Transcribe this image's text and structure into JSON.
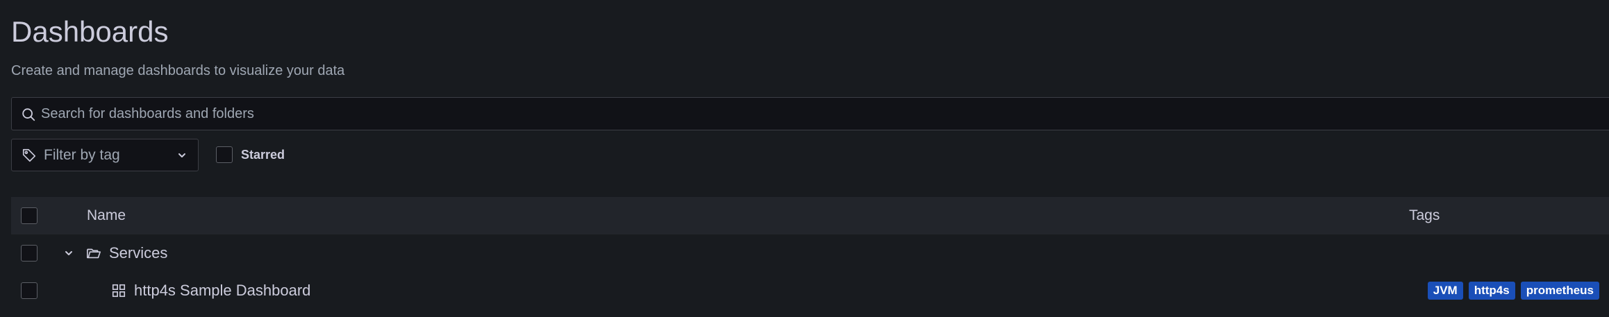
{
  "page": {
    "title": "Dashboards",
    "subtitle": "Create and manage dashboards to visualize your data"
  },
  "search": {
    "placeholder": "Search for dashboards and folders",
    "icon": "search-icon"
  },
  "filters": {
    "tag_filter_label": "Filter by tag",
    "tag_icon": "tag-icon",
    "starred_label": "Starred",
    "starred_checked": false
  },
  "table": {
    "columns": {
      "name": "Name",
      "tags": "Tags"
    },
    "rows": [
      {
        "type": "folder",
        "label": "Services",
        "expanded": true,
        "icon": "folder-open-icon",
        "tags": []
      },
      {
        "type": "dashboard",
        "label": "http4s Sample Dashboard",
        "icon": "grid-icon",
        "tags": [
          {
            "label": "JVM",
            "color": "#1a4fb8"
          },
          {
            "label": "http4s",
            "color": "#1a4fb8"
          },
          {
            "label": "prometheus",
            "color": "#1a4fb8"
          }
        ]
      }
    ]
  },
  "colors": {
    "background": "#181b1f",
    "header_row": "#22252b",
    "input_background": "#111217",
    "text_primary": "#ccccdc",
    "text_secondary": "#9fa7b3",
    "tag_blue": "#1a4fb8"
  }
}
